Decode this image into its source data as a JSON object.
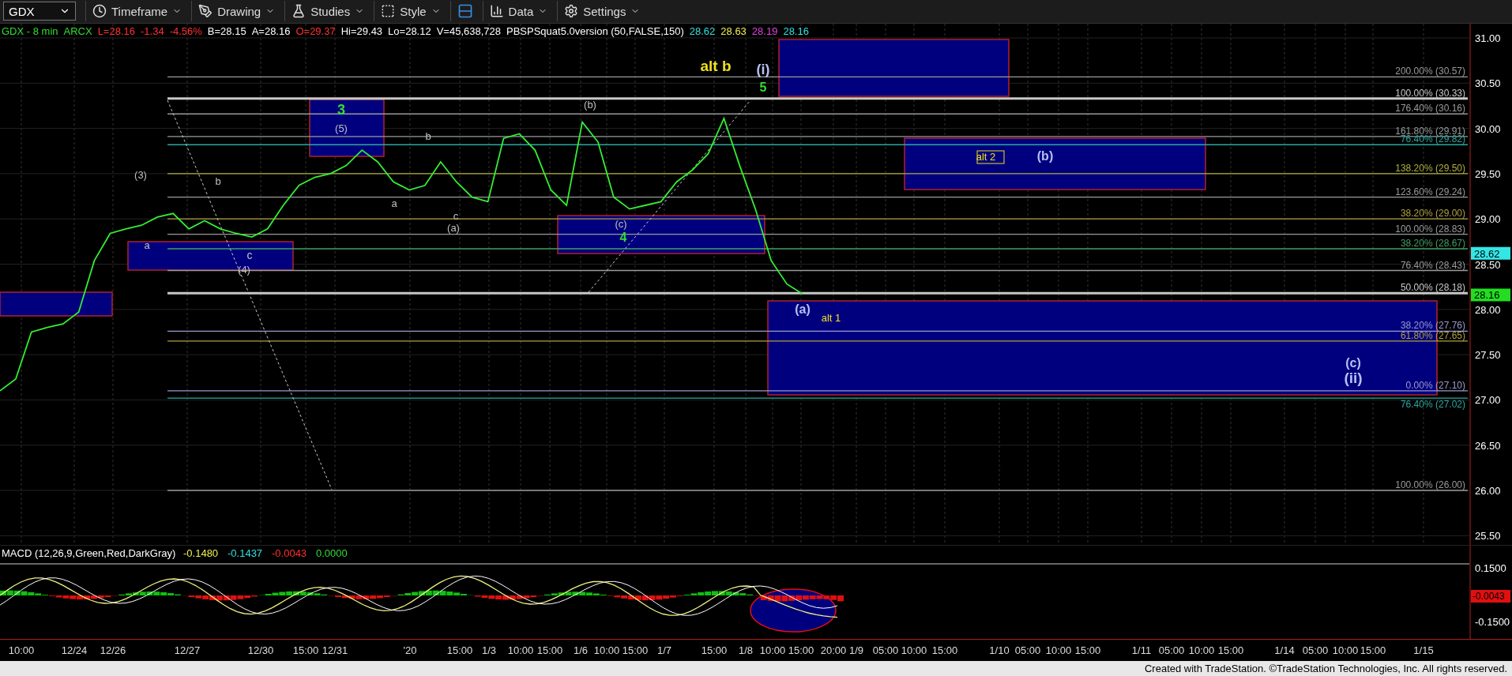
{
  "toolbar": {
    "symbol": "GDX",
    "buttons": [
      {
        "label": "Timeframe"
      },
      {
        "label": "Drawing"
      },
      {
        "label": "Studies"
      },
      {
        "label": "Style"
      },
      {
        "label": "Data"
      },
      {
        "label": "Settings"
      }
    ]
  },
  "legend": [
    {
      "text": "GDX - 8 min",
      "color": "#33dd33"
    },
    {
      "text": "ARCX",
      "color": "#33dd33"
    },
    {
      "text": "L=28.16",
      "color": "#ff3030"
    },
    {
      "text": "-1.34",
      "color": "#ff3030"
    },
    {
      "text": "-4.56%",
      "color": "#ff3030"
    },
    {
      "text": "B=28.15",
      "color": "#ffffff"
    },
    {
      "text": "A=28.16",
      "color": "#ffffff"
    },
    {
      "text": "O=29.37",
      "color": "#ff3030"
    },
    {
      "text": "Hi=29.43",
      "color": "#ffffff"
    },
    {
      "text": "Lo=28.12",
      "color": "#ffffff"
    },
    {
      "text": "V=45,638,728",
      "color": "#ffffff"
    },
    {
      "text": "PBSPSquat5.0version (50,FALSE,150)",
      "color": "#ffffff"
    },
    {
      "text": "28.62",
      "color": "#33e0e0"
    },
    {
      "text": "28.63",
      "color": "#f0f050"
    },
    {
      "text": "28.19",
      "color": "#e040e0"
    },
    {
      "text": "28.16",
      "color": "#33e0e0"
    }
  ],
  "price_axis": [
    "31.00",
    "30.50",
    "30.00",
    "29.50",
    "29.00",
    "28.50",
    "28.00",
    "27.50",
    "27.00",
    "26.50",
    "26.00",
    "25.50"
  ],
  "fib_levels": [
    {
      "label": "200.00% (30.57)",
      "color": "#9a9a9a"
    },
    {
      "label": "100.00% (30.33)",
      "color": "#c8c8c8"
    },
    {
      "label": "176.40% (30.16)",
      "color": "#9a9a9a"
    },
    {
      "label": "161.80% (29.91)",
      "color": "#9a9a9a"
    },
    {
      "label": "76.40% (29.82)",
      "color": "#2aa8a0"
    },
    {
      "label": "138.20% (29.50)",
      "color": "#b0b040"
    },
    {
      "label": "123.60% (29.24)",
      "color": "#9a9a9a"
    },
    {
      "label": "38.20% (29.00)",
      "color": "#b0a040"
    },
    {
      "label": "100.00% (28.83)",
      "color": "#9a9a9a"
    },
    {
      "label": "38.20% (28.67)",
      "color": "#40a060"
    },
    {
      "label": "76.40% (28.43)",
      "color": "#9a9a9a"
    },
    {
      "label": "50.00% (28.18)",
      "color": "#c8c8c8"
    },
    {
      "label": "38.20% (27.76)",
      "color": "#9a9ad0"
    },
    {
      "label": "61.80% (27.65)",
      "color": "#b0a040"
    },
    {
      "label": "0.00% (27.10)",
      "color": "#9a9ad0"
    },
    {
      "label": "76.40% (27.02)",
      "color": "#2aa8a0"
    },
    {
      "label": "100.00% (26.00)",
      "color": "#9a9a9a"
    }
  ],
  "wave_labels": [
    {
      "text": "alt b",
      "color": "#f0e020"
    },
    {
      "text": "(i)",
      "color": "#b8c0f0"
    },
    {
      "text": "5",
      "color": "#33dd33"
    },
    {
      "text": "3",
      "color": "#33dd33"
    },
    {
      "text": "(5)",
      "color": "#c0c0c0"
    },
    {
      "text": "(3)",
      "color": "#c0c0c0"
    },
    {
      "text": "a",
      "color": "#c0c0c0"
    },
    {
      "text": "b",
      "color": "#c0c0c0"
    },
    {
      "text": "c",
      "color": "#c0c0c0"
    },
    {
      "text": "(4)",
      "color": "#c0c0c0"
    },
    {
      "text": "b",
      "color": "#c0c0c0"
    },
    {
      "text": "a",
      "color": "#c0c0c0"
    },
    {
      "text": "c",
      "color": "#c0c0c0"
    },
    {
      "text": "(a)",
      "color": "#c0c0c0"
    },
    {
      "text": "(b)",
      "color": "#c0c0c0"
    },
    {
      "text": "(c)",
      "color": "#c0c0c0"
    },
    {
      "text": "4",
      "color": "#33dd33"
    },
    {
      "text": "alt 2",
      "color": "#f0e020"
    },
    {
      "text": "(b)",
      "color": "#b8c0f0"
    },
    {
      "text": "(a)",
      "color": "#b8c0f0"
    },
    {
      "text": "alt 1",
      "color": "#f0e020"
    },
    {
      "text": "(c)",
      "color": "#b8c0f0"
    },
    {
      "text": "(ii)",
      "color": "#b8c0f0"
    }
  ],
  "price_markers": [
    {
      "label": "28.62",
      "color": "#33e6e6"
    },
    {
      "label": "28.16",
      "color": "#22dd22"
    }
  ],
  "macd": {
    "title": "MACD (12,26,9,Green,Red,DarkGray)",
    "values": [
      {
        "text": "-0.1480",
        "color": "#f0f050"
      },
      {
        "text": "-0.1437",
        "color": "#33e0e0"
      },
      {
        "text": "-0.0043",
        "color": "#ff3030"
      },
      {
        "text": "0.0000",
        "color": "#33dd33"
      }
    ],
    "ticks": [
      "0.1500",
      "-0.1500"
    ],
    "marker": "-0.0043"
  },
  "time_axis": [
    "10:00",
    "12/24",
    "12/26",
    "12/27",
    "12/30",
    "15:00",
    "12/31",
    "'20",
    "15:00",
    "1/3",
    "10:00",
    "15:00",
    "1/6",
    "10:00",
    "15:00",
    "1/7",
    "15:00",
    "1/8",
    "10:00",
    "15:00",
    "20:00",
    "1/9",
    "05:00",
    "10:00",
    "15:00",
    "1/10",
    "05:00",
    "10:00",
    "15:00",
    "1/11",
    "05:00",
    "10:00",
    "15:00",
    "1/14",
    "05:00",
    "10:00",
    "15:00",
    "1/15"
  ],
  "footer": "Created with TradeStation. ©TradeStation Technologies, Inc. All rights reserved."
}
